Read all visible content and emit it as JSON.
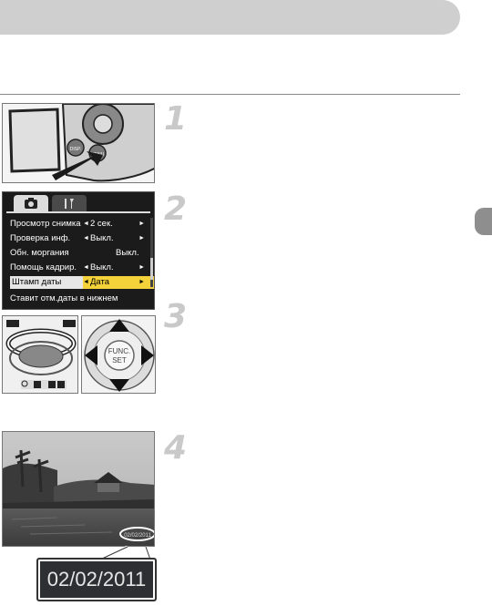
{
  "steps": [
    "1",
    "2",
    "3",
    "4"
  ],
  "menu": {
    "rows": [
      {
        "label": "Просмотр снимка",
        "value": "2 сек."
      },
      {
        "label": "Проверка инф.",
        "value": "Выкл."
      },
      {
        "label": "Обн. моргания",
        "value": "Выкл."
      },
      {
        "label": "Помощь кадрир.",
        "value": "Выкл."
      },
      {
        "label": "Штамп даты",
        "value": "Дата"
      }
    ],
    "hint": "Ставит отм.даты в нижнем"
  },
  "controls": {
    "func_label": "FUNC.",
    "set_label": "SET",
    "disp_label": "DISP.",
    "menu_label": "MENU"
  },
  "photo": {
    "date_stamp": "02/02/2011"
  }
}
